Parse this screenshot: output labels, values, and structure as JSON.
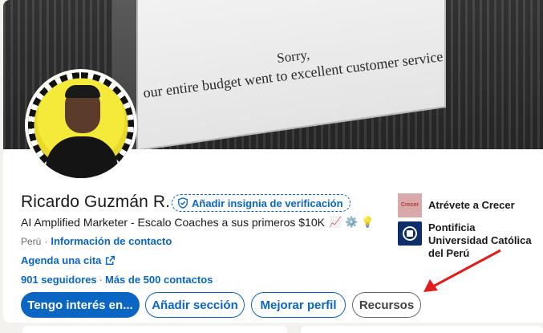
{
  "banner": {
    "line1": "Sorry,",
    "line2": "our entire budget went to excellent customer service"
  },
  "profile": {
    "name": "Ricardo Guzmán R.",
    "verify_label": "Añadir insignia de verificación",
    "headline": "AI Amplified Marketer - Escalo Coaches a sus primeros $10K",
    "headline_emojis": [
      "📈",
      "⚙️",
      "💡"
    ],
    "location": "Perú",
    "contact_link": "Información de contacto",
    "agenda_link": "Agenda una cita",
    "followers": "901 seguidores",
    "connections": "Más de 500 contactos"
  },
  "actions": {
    "primary": "Tengo interés en...",
    "add_section": "Añadir sección",
    "improve": "Mejorar perfil",
    "resources": "Recursos"
  },
  "side": {
    "company": "Atrévete a Crecer",
    "company_logo_text": "Crecer",
    "school": "Pontificia Universidad Católica del Perú"
  },
  "colors": {
    "accent": "#0a66c2",
    "annotation": "#e11d1d"
  },
  "icons": {
    "verify": "shield-check-icon",
    "external": "external-link-icon"
  }
}
